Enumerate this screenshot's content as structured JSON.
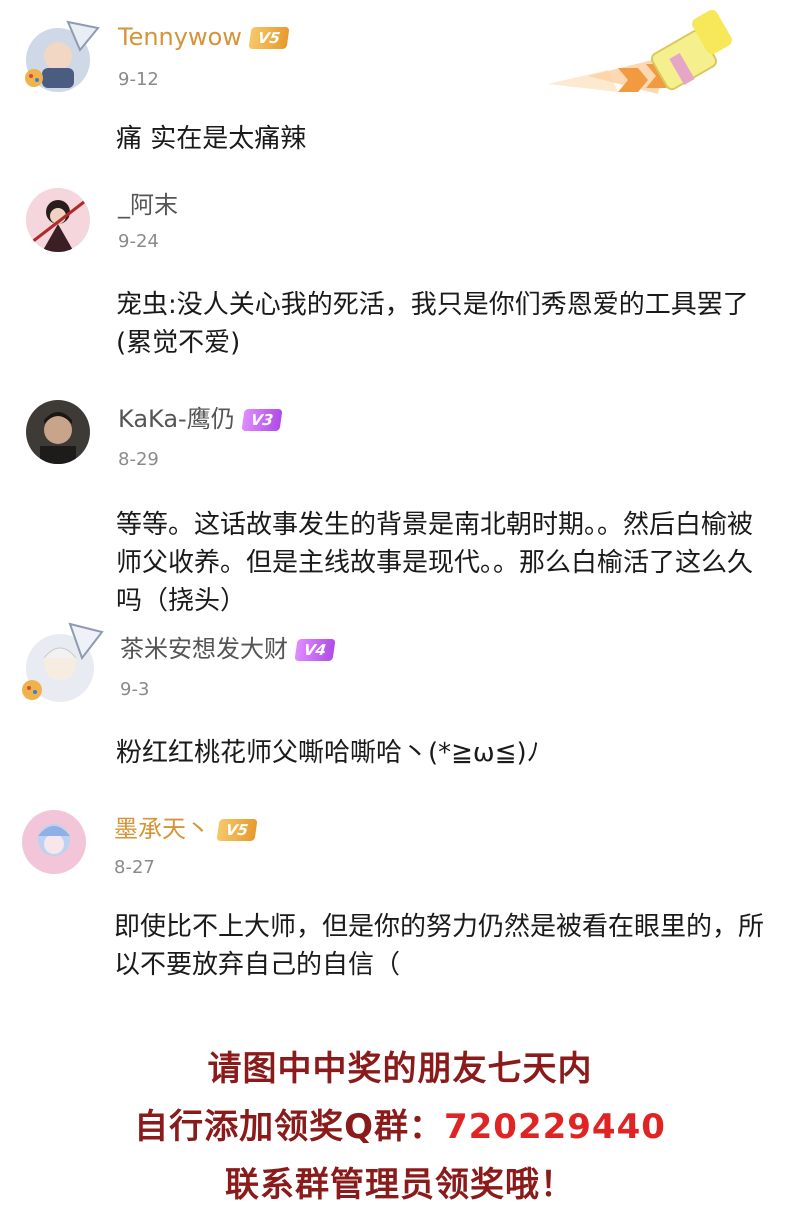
{
  "comments": [
    {
      "username": "Tennywow",
      "vip": "V5",
      "date": "9-12",
      "text": "痛 实在是太痛辣",
      "name_color": "#d69438"
    },
    {
      "username": "_阿末",
      "vip": "",
      "date": "9-24",
      "text": "宠虫:没人关心我的死活，我只是你们秀恩爱的工具罢了(累觉不爱)",
      "name_color": "#555555"
    },
    {
      "username": "KaKa-鹰仍",
      "vip": "V3",
      "date": "8-29",
      "text": "等等。这话故事发生的背景是南北朝时期。。然后白榆被师父收养。但是主线故事是现代。。那么白榆活了这么久吗（挠头）",
      "name_color": "#555555"
    },
    {
      "username": "茶米安想发大财",
      "vip": "V4",
      "date": "9-3",
      "text": "粉红红桃花师父嘶哈嘶哈丶(*≧ω≦)ﾉ",
      "name_color": "#555555"
    },
    {
      "username": "墨承天丶",
      "vip": "V5",
      "date": "8-27",
      "text": "即使比不上大师，但是你的努力仍然是被看在眼里的，所以不要放弃自己的自信（",
      "name_color": "#d69438"
    }
  ],
  "footer": {
    "line1": "请图中中奖的朋友七天内",
    "line2_prefix": "自行添加领奖Q群：",
    "line2_number": "720229440",
    "line3": "联系群管理员领奖哦！"
  },
  "colors": {
    "footer_text": "#8b1a1a",
    "footer_number": "#e02424",
    "vip_gold": "#e79a2c",
    "vip_purple": "#b04be6"
  },
  "icons": [
    "paintbrush-decoration"
  ]
}
